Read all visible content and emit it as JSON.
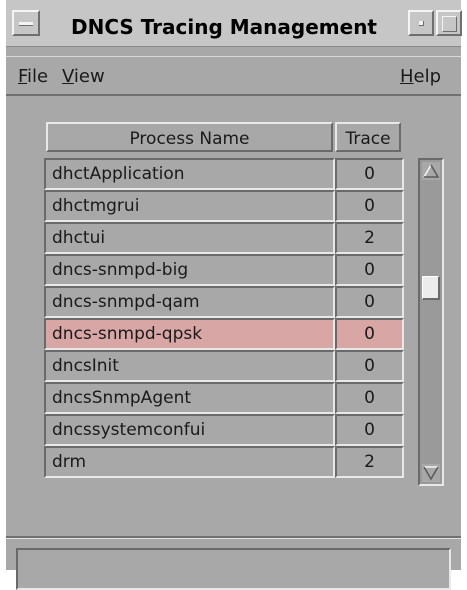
{
  "window": {
    "title": "DNCS Tracing Management"
  },
  "menubar": {
    "file": {
      "mnemonic": "F",
      "rest": "ile"
    },
    "view": {
      "mnemonic": "V",
      "rest": "iew"
    },
    "help": {
      "mnemonic": "H",
      "rest": "elp"
    }
  },
  "table": {
    "headers": {
      "process_name": "Process Name",
      "trace": "Trace"
    },
    "rows": [
      {
        "name": "dhctApplication",
        "trace": "0"
      },
      {
        "name": "dhctmgrui",
        "trace": "0"
      },
      {
        "name": "dhctui",
        "trace": "2"
      },
      {
        "name": "dncs-snmpd-big",
        "trace": "0"
      },
      {
        "name": "dncs-snmpd-qam",
        "trace": "0"
      },
      {
        "name": "dncs-snmpd-qpsk",
        "trace": "0"
      },
      {
        "name": "dncsInit",
        "trace": "0"
      },
      {
        "name": "dncsSnmpAgent",
        "trace": "0"
      },
      {
        "name": "dncssystemconfui",
        "trace": "0"
      },
      {
        "name": "drm",
        "trace": "2"
      }
    ],
    "selected_row_index": 5,
    "selected_color": "#d9a6a6"
  },
  "scrollbar": {
    "up_icon": "scroll-up-arrow-icon",
    "down_icon": "scroll-down-arrow-icon"
  },
  "statusbar": {
    "text": ""
  }
}
